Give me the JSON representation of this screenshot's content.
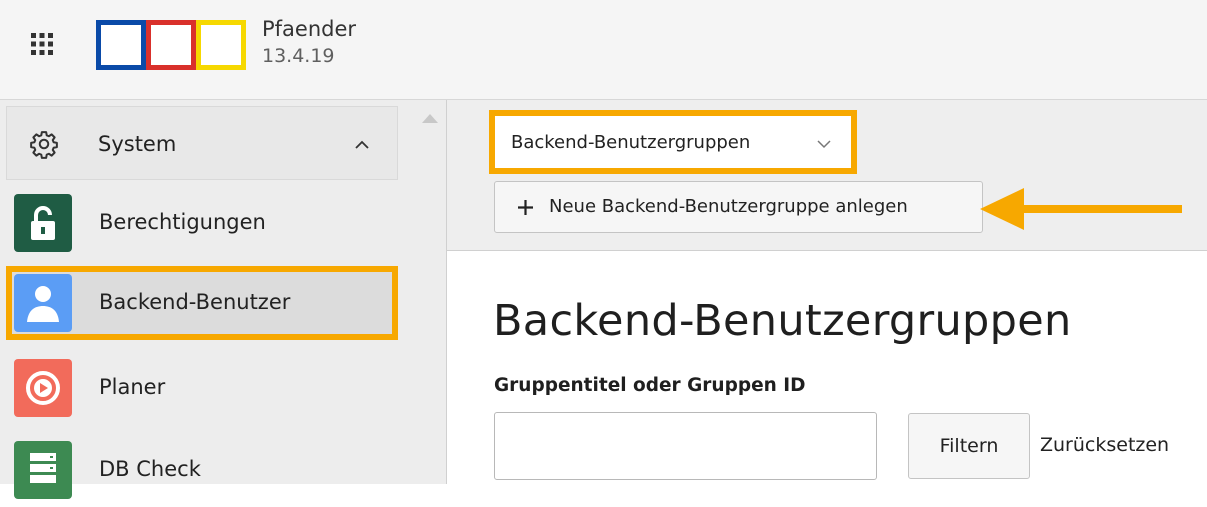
{
  "topbar": {
    "apps_icon": "grid-icon",
    "logo": {
      "colors": [
        "#0a4aa8",
        "#d9302b",
        "#f6d800"
      ]
    },
    "site_name": "Pfaender",
    "version": "13.4.19"
  },
  "sidebar": {
    "group": {
      "label": "System",
      "icon": "gear-icon",
      "expanded": true
    },
    "items": [
      {
        "label": "Berechtigungen",
        "icon": "lock-icon",
        "color": "#1f5c44"
      },
      {
        "label": "Backend-Benutzer",
        "icon": "user-icon",
        "color": "#5b9df5",
        "active": true
      },
      {
        "label": "Planer",
        "icon": "scheduler-icon",
        "color": "#f26b5b"
      },
      {
        "label": "DB Check",
        "icon": "database-icon",
        "color": "#3d8a52"
      }
    ]
  },
  "docheader": {
    "dropdown": {
      "selected": "Backend-Benutzergruppen"
    },
    "new_button": {
      "label": "Neue Backend-Benutzergruppe anlegen",
      "icon": "plus-icon"
    }
  },
  "main": {
    "title": "Backend-Benutzergruppen",
    "filter_label": "Gruppentitel oder Gruppen ID",
    "search": {
      "value": "",
      "placeholder": ""
    },
    "filter_button": "Filtern",
    "reset_link": "Zurücksetzen"
  },
  "annotation": {
    "highlight_color": "#f7a800"
  }
}
